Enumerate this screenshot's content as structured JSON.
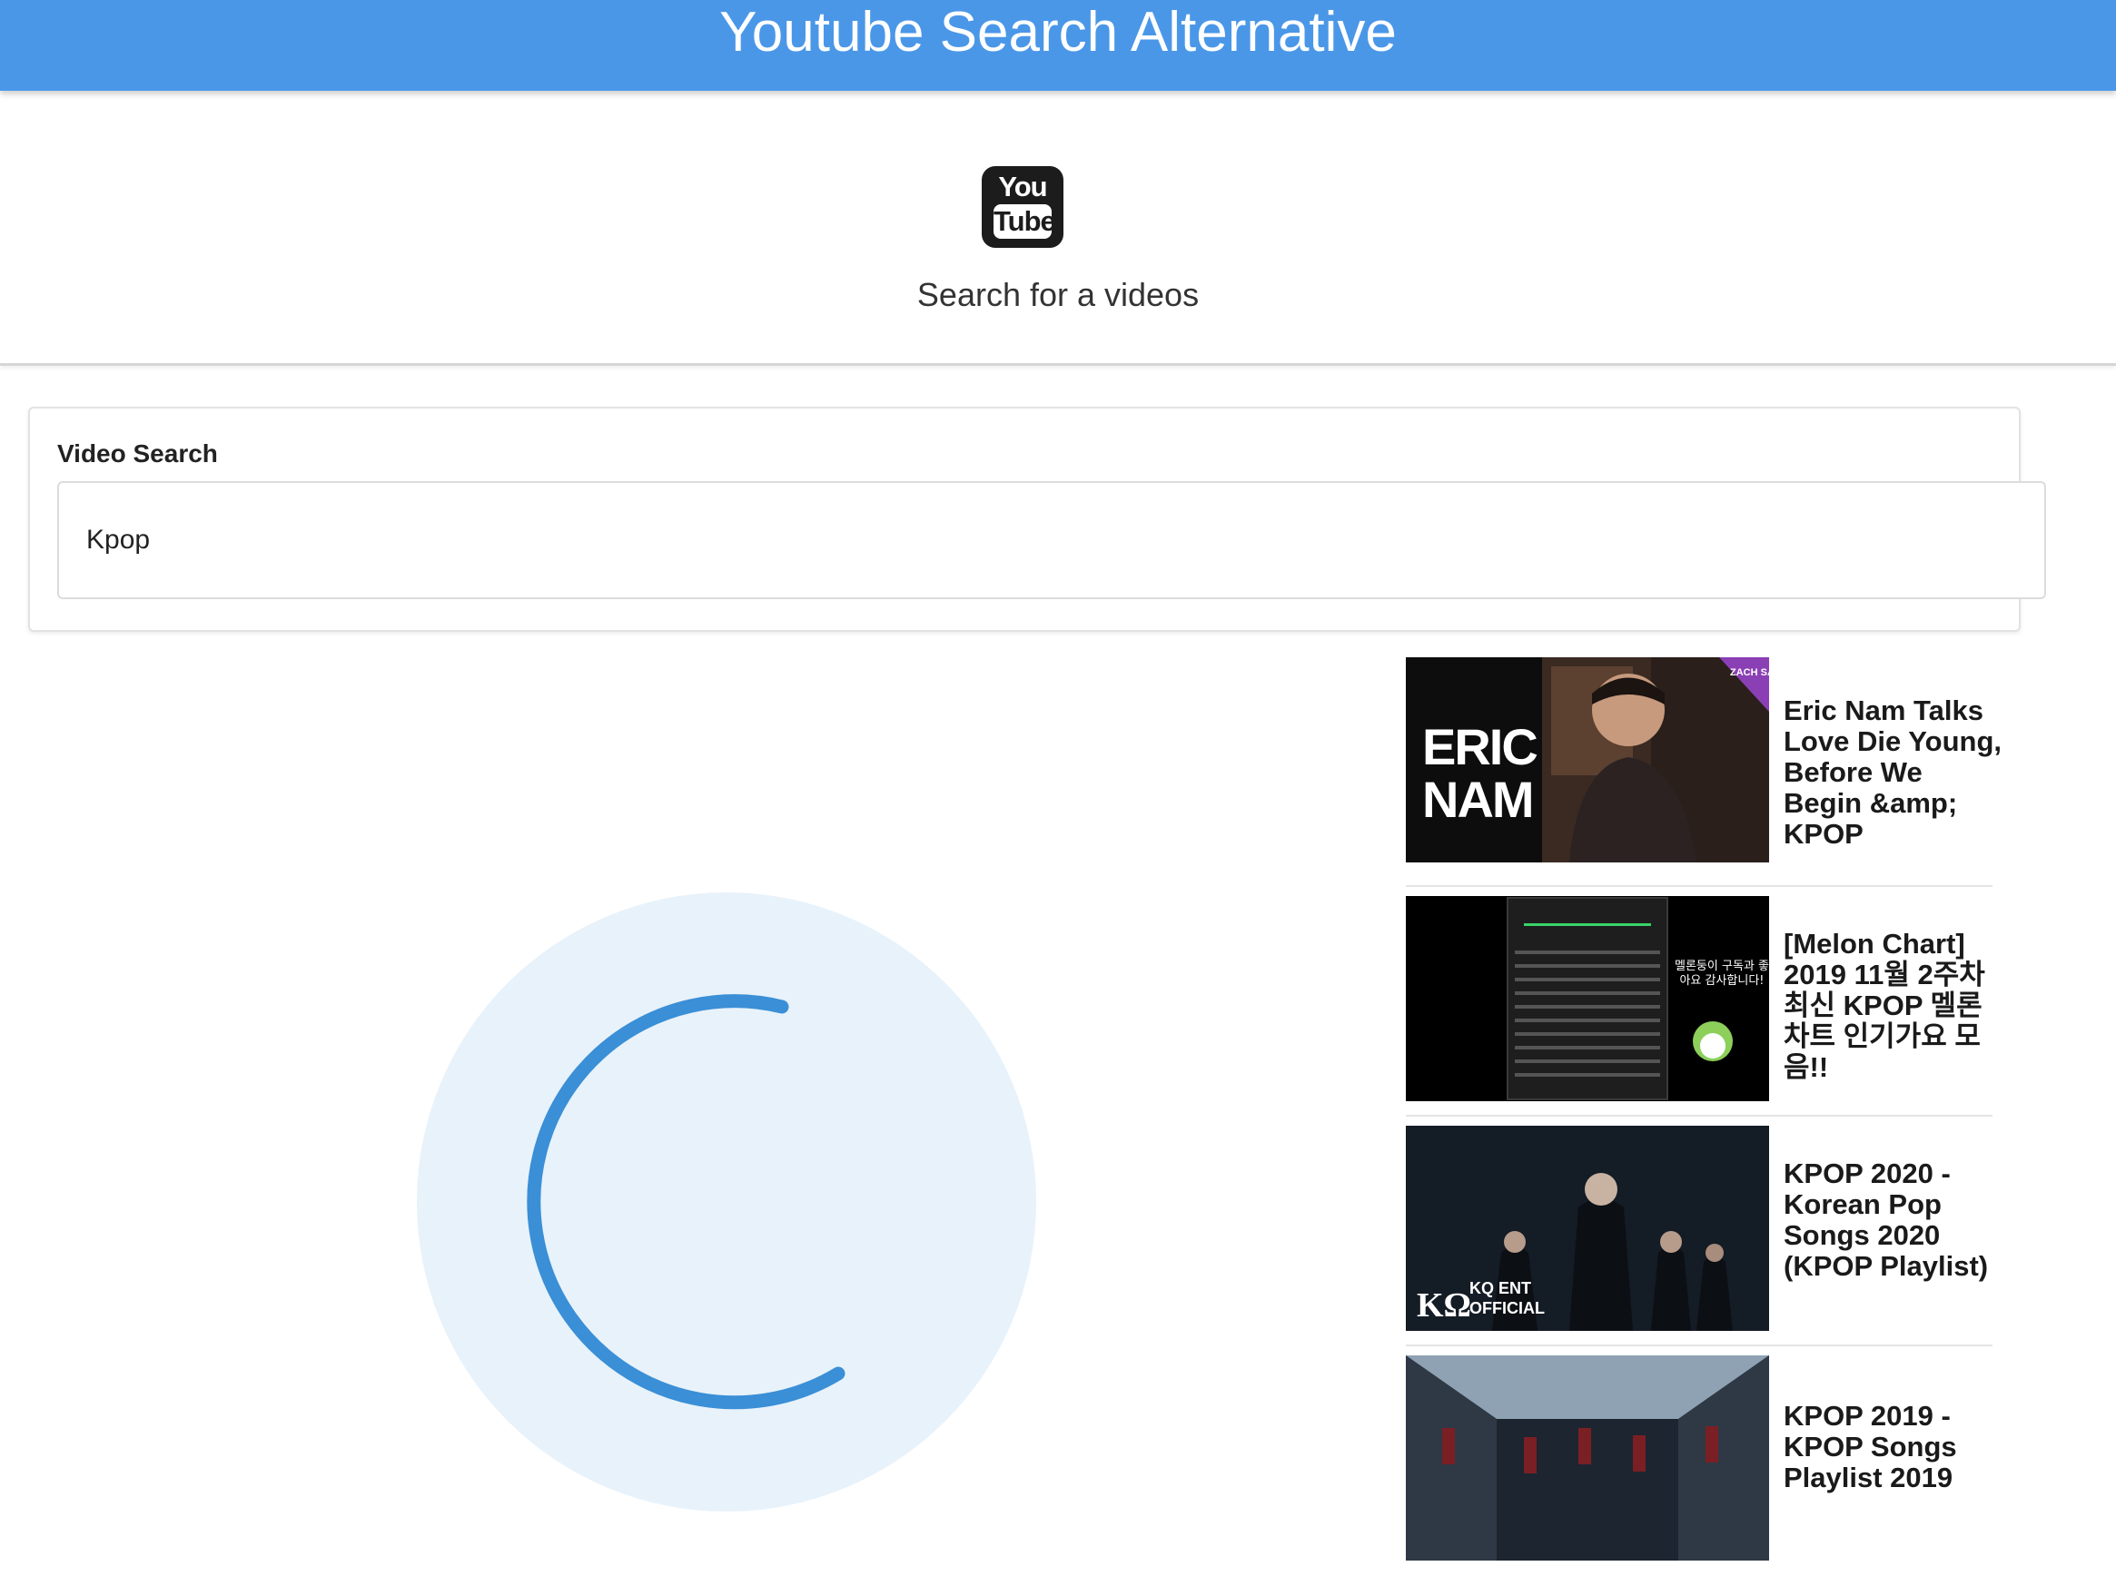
{
  "header": {
    "title": "Youtube Search Alternative"
  },
  "hero": {
    "logo_you": "You",
    "logo_tube": "Tube",
    "subtitle": "Search for a videos"
  },
  "search": {
    "label": "Video Search",
    "value": "Kpop"
  },
  "loading": {
    "state": "spinner"
  },
  "results": [
    {
      "title": "Eric Nam Talks Love Die Young, Before We Begin &amp; KPOP",
      "thumb_text": "ERIC NAM",
      "thumb_badge": "ZACH SANG SHOW"
    },
    {
      "title": "[Melon Chart] 2019 11월 2주차 최신 KPOP 멜론차트 인기가요 모음!!",
      "thumb_text": "멜론둥이 구독과 좋아요 감사합니다!"
    },
    {
      "title": "KPOP 2020 - Korean Pop Songs 2020 (KPOP Playlist)",
      "thumb_text": "KQ ENT OFFICIAL"
    },
    {
      "title": "KPOP 2019 - KPOP Songs Playlist 2019"
    }
  ],
  "colors": {
    "header_bg": "#4a97e8",
    "spinner_track": "#e8f2fa",
    "spinner_arc": "#3a8fd6"
  }
}
